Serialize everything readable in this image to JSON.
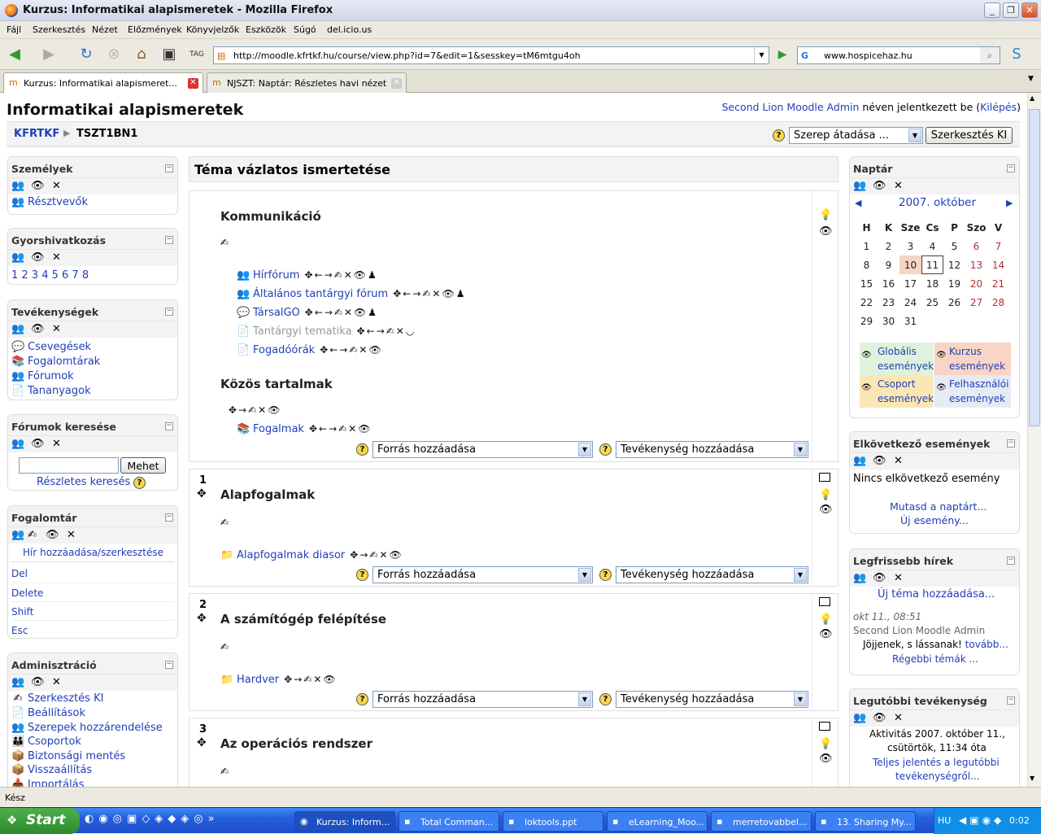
{
  "window": {
    "title": "Kurzus: Informatikai alapismeretek - Mozilla Firefox"
  },
  "menu": [
    "Fájl",
    "Szerkesztés",
    "Nézet",
    "Előzmények",
    "Könyvjelzők",
    "Eszközök",
    "Súgó",
    "del.icio.us"
  ],
  "nav": {
    "url": "http://moodle.kfrtkf.hu/course/view.php?id=7&edit=1&sesskey=tM6mtgu4oh",
    "search": "www.hospicehaz.hu",
    "tag_label": "TAG"
  },
  "tabs": [
    {
      "label": "Kurzus: Informatikai alapismeret..."
    },
    {
      "label": "NJSZT: Naptár: Részletes havi nézet"
    }
  ],
  "header": {
    "course_title": "Informatikai alapismeretek",
    "user_name": "Second Lion Moodle Admin",
    "login_text": "néven jelentkezett be (",
    "logout": "Kilépés",
    "close_paren": ")"
  },
  "breadcrumb": {
    "home": "KFRTKF",
    "sep": "▶",
    "current": "TSZT1BN1"
  },
  "role": {
    "select": "Szerep átadása ...",
    "button": "Szerkesztés KI"
  },
  "left": {
    "people": {
      "title": "Személyek",
      "items": [
        "Résztvevők"
      ]
    },
    "shortcuts": {
      "title": "Gyorshivatkozás",
      "nums": "1 2 3 4 5 6 7 8"
    },
    "activities": {
      "title": "Tevékenységek",
      "items": [
        "Csevegések",
        "Fogalomtárak",
        "Fórumok",
        "Tananyagok"
      ]
    },
    "forumsearch": {
      "title": "Fórumok keresése",
      "button": "Mehet",
      "advanced": "Részletes keresés"
    },
    "glossary": {
      "title": "Fogalomtár",
      "add": "Hír hozzáadása/szerkesztése",
      "entries": [
        "Del",
        "Delete",
        "Shift",
        "Esc"
      ]
    },
    "admin": {
      "title": "Adminisztráció",
      "items": [
        "Szerkesztés KI",
        "Beállítások",
        "Szerepek hozzárendelése",
        "Csoportok",
        "Biztonsági mentés",
        "Visszaállítás",
        "Importálás"
      ]
    }
  },
  "main": {
    "heading": "Téma vázlatos ismertetése",
    "sec0": {
      "group1": "Kommunikáció",
      "items": [
        "Hírfórum",
        "Általános tantárgyi fórum",
        "TársalGO",
        "Tantárgyi tematika",
        "Fogadóórák"
      ],
      "group2": "Közös tartalmak",
      "items2": [
        "Fogalmak"
      ]
    },
    "sec1": {
      "num": "1",
      "title": "Alapfogalmak",
      "items": [
        "Alapfogalmak diasor"
      ]
    },
    "sec2": {
      "num": "2",
      "title": "A számítógép felépítése",
      "items": [
        "Hardver"
      ]
    },
    "sec3": {
      "num": "3",
      "title": "Az operációs rendszer"
    },
    "add_resource": "Forrás hozzáadása",
    "add_activity": "Tevékenység hozzáadása"
  },
  "right": {
    "calendar": {
      "title": "Naptár",
      "month": "2007. október",
      "days": [
        "H",
        "K",
        "Sze",
        "Cs",
        "P",
        "Szo",
        "V"
      ],
      "weeks": [
        [
          "1",
          "2",
          "3",
          "4",
          "5",
          "6",
          "7"
        ],
        [
          "8",
          "9",
          "10",
          "11",
          "12",
          "13",
          "14"
        ],
        [
          "15",
          "16",
          "17",
          "18",
          "19",
          "20",
          "21"
        ],
        [
          "22",
          "23",
          "24",
          "25",
          "26",
          "27",
          "28"
        ],
        [
          "29",
          "30",
          "31",
          "",
          "",
          "",
          ""
        ]
      ],
      "legend": [
        "Globális események",
        "Kurzus események",
        "Csoport események",
        "Felhasználói események"
      ]
    },
    "upcoming": {
      "title": "Elkövetkező események",
      "none": "Nincs elkövetkező esemény",
      "show": "Mutasd a naptárt...",
      "new": "Új esemény..."
    },
    "news": {
      "title": "Legfrissebb hírek",
      "add": "Új téma hozzáadása...",
      "date": "okt 11., 08:51",
      "author": "Second Lion Moodle Admin",
      "text": "Jöjjenek, s lássanak!",
      "more": "tovább...",
      "older": "Régebbi témák ..."
    },
    "recent": {
      "title": "Legutóbbi tevékenység",
      "activity": "Aktivitás 2007. október 11.,",
      "day": "csütörtök, 11:34 óta",
      "full": "Teljes jelentés a legutóbbi",
      "full2": "tevékenységről..."
    }
  },
  "status": "Kész",
  "taskbar": {
    "start": "Start",
    "items": [
      "Kurzus: Inform...",
      "Total Comman...",
      "loktools.ppt",
      "eLearning_Moo...",
      "merretovabbel...",
      "13. Sharing My..."
    ],
    "lang": "HU",
    "clock": "0:02"
  }
}
